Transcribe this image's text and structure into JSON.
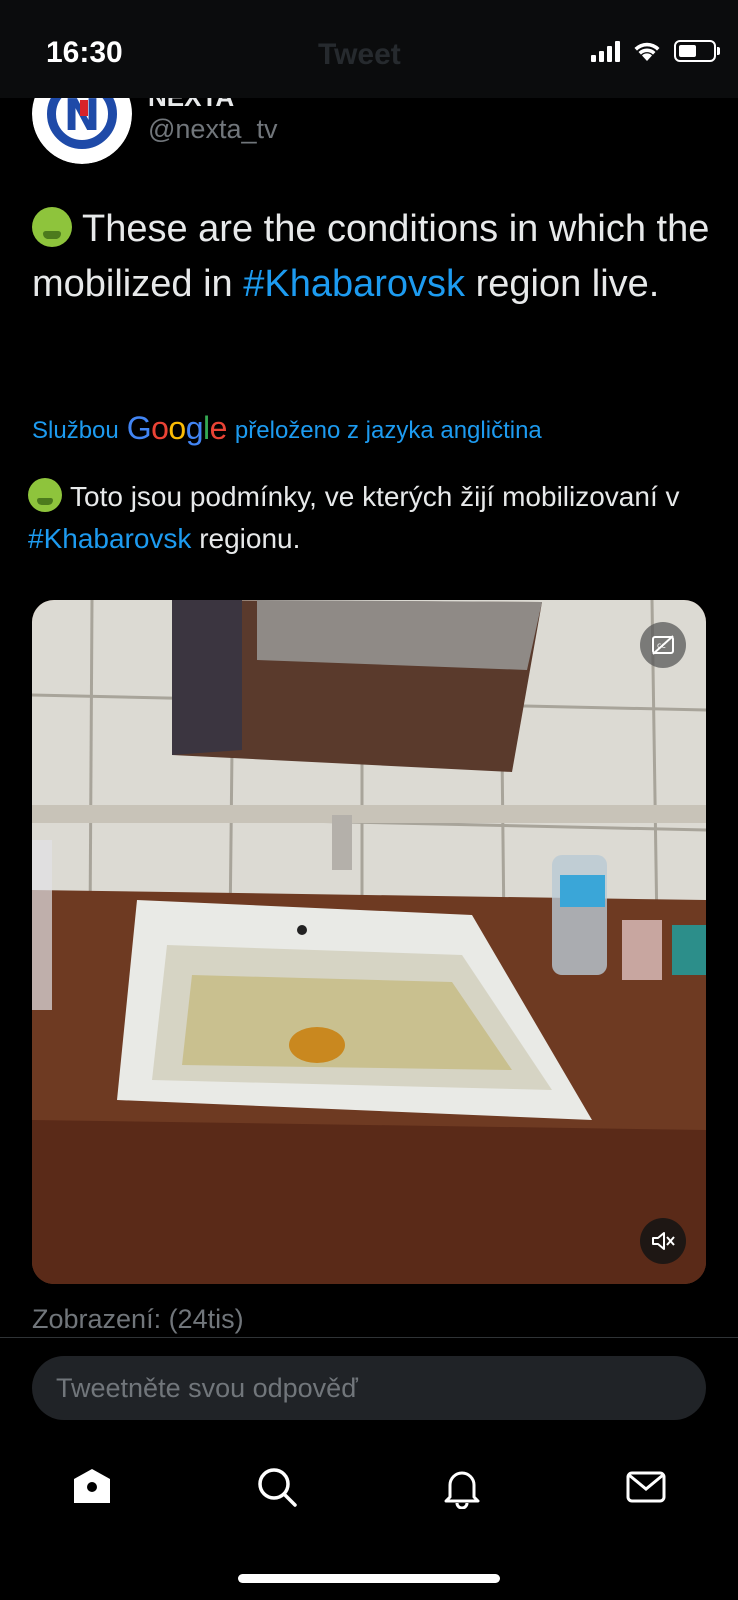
{
  "status_bar": {
    "time": "16:30",
    "header_title": "Tweet",
    "icons": [
      "cellular-signal-icon",
      "wifi-icon",
      "battery-icon"
    ]
  },
  "tweet": {
    "author_name": "NEXTA",
    "verified": true,
    "handle": "@nexta_tv",
    "text_before_tag": "These are the conditions in which the mobilized in ",
    "hashtag": "#Khabarovsk",
    "text_after_tag": " region live.",
    "emoji": "nauseated-face-emoji",
    "translation": {
      "prefix": "Službou",
      "brand": "Google",
      "suffix": "přeloženo z jazyka angličtina",
      "text_before_tag": "Toto jsou podmínky, ve kterých žijí mobilizovaní v ",
      "hashtag": "#Khabarovsk",
      "text_after_tag": " regionu."
    },
    "media": {
      "kind": "video",
      "controls": [
        "closed-captions-icon",
        "mute-icon"
      ]
    },
    "views": "Zobrazení: (24tis)"
  },
  "reply": {
    "placeholder": "Tweetněte svou odpověď"
  },
  "tab_bar": {
    "items": [
      "home-icon",
      "search-icon",
      "notifications-icon",
      "messages-icon"
    ]
  },
  "colors": {
    "background": "#000000",
    "text": "#e7e9ea",
    "secondary_text": "#71767b",
    "link": "#1d9bf0",
    "input_background": "#202327"
  }
}
